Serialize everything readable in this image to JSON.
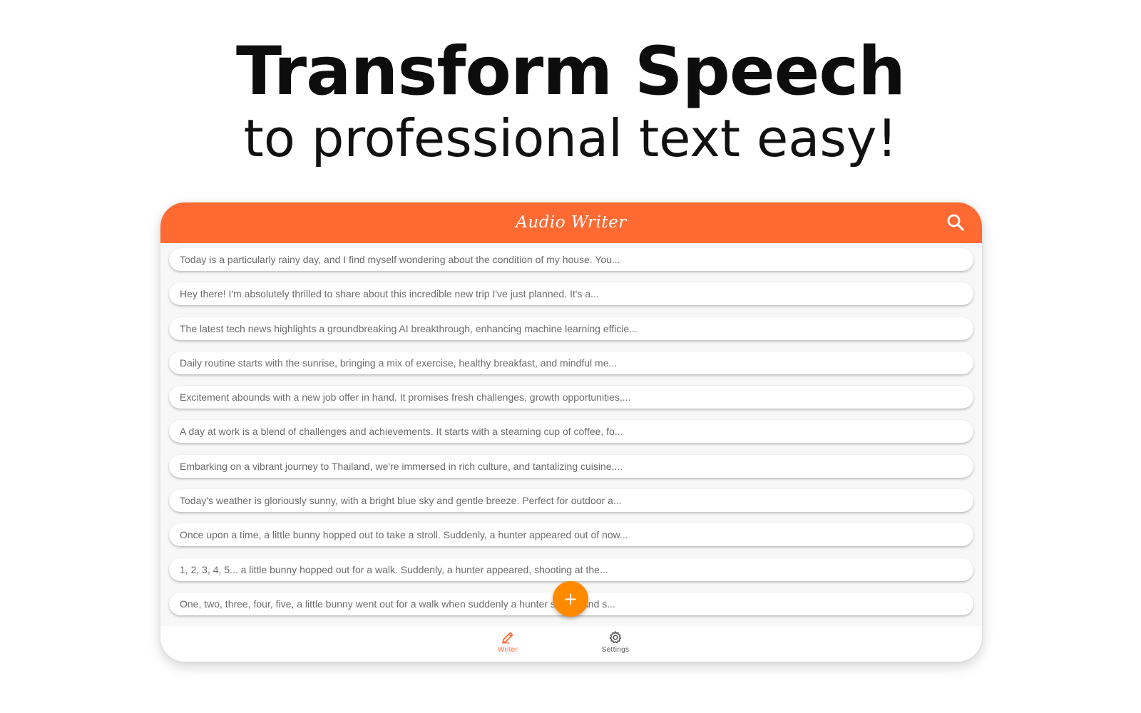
{
  "promo": {
    "headline": "Transform Speech",
    "subheadline": "to professional text easy!"
  },
  "app": {
    "title": "Audio Writer",
    "accent_color": "#ff6a33",
    "fab_color": "#ff8a00",
    "search_icon": "search-icon",
    "fab_label": "+",
    "fab_icon": "plus-icon"
  },
  "notes": [
    "Today is a particularly rainy day, and I find myself wondering about the condition of my house. You...",
    "Hey there! I'm absolutely thrilled to share about this incredible new trip I've just planned. It's a...",
    "The latest tech news highlights a groundbreaking AI breakthrough, enhancing machine learning efficie...",
    "Daily routine starts with the sunrise, bringing a mix of exercise, healthy breakfast, and mindful me...",
    "Excitement abounds with a new job offer in hand. It promises fresh challenges, growth opportunities,...",
    "A day at work is a blend of challenges and achievements. It starts with a steaming cup of coffee, fo...",
    "Embarking on a vibrant journey to Thailand, we're immersed in rich culture, and tantalizing cuisine....",
    "Today's weather is gloriously sunny, with a bright blue sky and gentle breeze. Perfect for outdoor a...",
    "Once upon a time, a little bunny hopped out to take a stroll. Suddenly, a hunter appeared out of now...",
    "1, 2, 3, 4, 5... a little bunny hopped out for a walk. Suddenly, a hunter appeared, shooting at the...",
    "One, two, three, four, five, a little bunny went out for a walk when suddenly a hunter shoots and s..."
  ],
  "bottom_nav": {
    "items": [
      {
        "label": "Writer",
        "icon": "pencil-icon",
        "active": true,
        "color": "#ff6a33"
      },
      {
        "label": "Settings",
        "icon": "gear-icon",
        "active": false,
        "color": "#555555"
      }
    ]
  }
}
